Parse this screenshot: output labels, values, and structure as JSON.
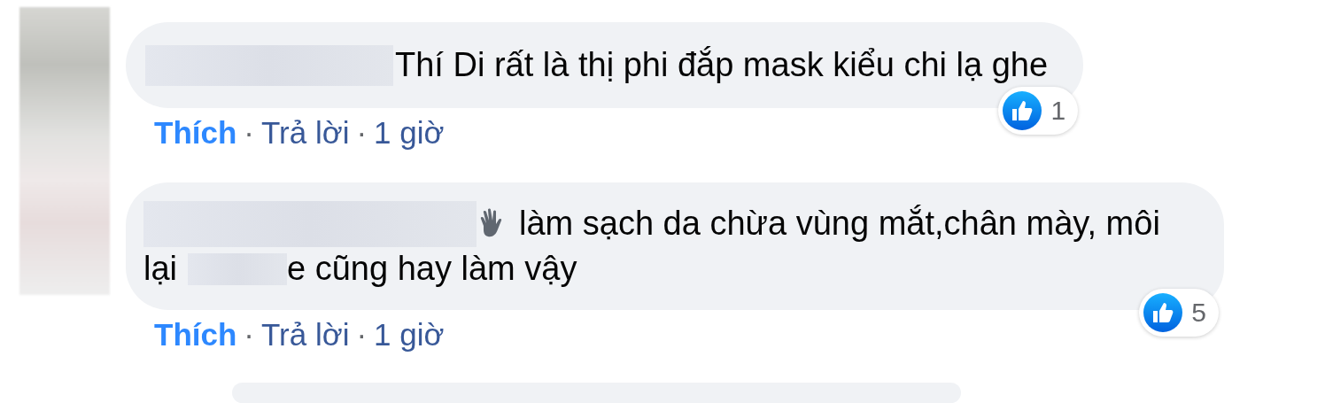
{
  "comments": [
    {
      "kind": "full",
      "lines": [
        [
          {
            "kind": "redacted"
          },
          {
            "kind": "text",
            "text": "Thí Di rất là thị phi đắp mask kiểu chi lạ ghe"
          }
        ]
      ],
      "actions": {
        "like": {
          "label": "Thích",
          "selected": true
        },
        "separator": "·",
        "reply": "Trả lời",
        "time": "1 giờ"
      },
      "reactions": "1"
    },
    {
      "kind": "full",
      "lines": [
        [
          {
            "kind": "redacted"
          },
          {
            "kind": "emoji"
          },
          {
            "kind": "text",
            "text": "làm sạch da chừa vùng mắt,chân mày, môi"
          }
        ],
        [
          {
            "kind": "text",
            "text": "lại"
          },
          {
            "kind": "redacted_short"
          },
          {
            "kind": "text",
            "text": "e cũng hay làm vậy"
          }
        ]
      ],
      "actions": {
        "like": {
          "label": "Thích",
          "selected": true
        },
        "separator": "·",
        "reply": "Trả lời",
        "time": "1 giờ"
      },
      "reactions": "5"
    },
    {
      "kind": "clipped"
    }
  ]
}
